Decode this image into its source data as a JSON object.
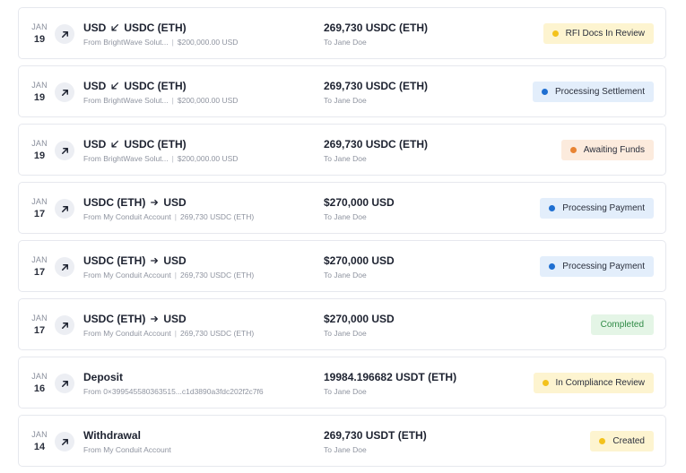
{
  "transactions": [
    {
      "month": "JAN",
      "day": "19",
      "kind": "conversion",
      "title_from": "USD",
      "title_to": "USDC (ETH)",
      "arrow": "arrow-down-left",
      "source": "From BrightWave Solut...",
      "source_amount": "$200,000.00 USD",
      "amount": "269,730 USDC (ETH)",
      "recipient": "To Jane Doe",
      "status": "RFI Docs In Review",
      "status_bg": "#fdf4d0",
      "status_dot": "#f3c21b",
      "status_text": "#2a2f3c"
    },
    {
      "month": "JAN",
      "day": "19",
      "kind": "conversion",
      "title_from": "USD",
      "title_to": "USDC (ETH)",
      "arrow": "arrow-down-left",
      "source": "From BrightWave Solut...",
      "source_amount": "$200,000.00 USD",
      "amount": "269,730 USDC (ETH)",
      "recipient": "To Jane Doe",
      "status": "Processing Settlement",
      "status_bg": "#e3eefb",
      "status_dot": "#1f6fd1",
      "status_text": "#2a2f3c"
    },
    {
      "month": "JAN",
      "day": "19",
      "kind": "conversion",
      "title_from": "USD",
      "title_to": "USDC (ETH)",
      "arrow": "arrow-down-left",
      "source": "From BrightWave Solut...",
      "source_amount": "$200,000.00 USD",
      "amount": "269,730 USDC (ETH)",
      "recipient": "To Jane Doe",
      "status": "Awaiting Funds",
      "status_bg": "#fcebdd",
      "status_dot": "#e88433",
      "status_text": "#2a2f3c"
    },
    {
      "month": "JAN",
      "day": "17",
      "kind": "conversion",
      "title_from": "USDC (ETH)",
      "title_to": "USD",
      "arrow": "arrow-right",
      "source": "From My Conduit Account",
      "source_amount": "269,730 USDC (ETH)",
      "amount": "$270,000 USD",
      "recipient": "To Jane Doe",
      "status": "Processing Payment",
      "status_bg": "#e3eefb",
      "status_dot": "#1f6fd1",
      "status_text": "#2a2f3c"
    },
    {
      "month": "JAN",
      "day": "17",
      "kind": "conversion",
      "title_from": "USDC (ETH)",
      "title_to": "USD",
      "arrow": "arrow-right",
      "source": "From My Conduit Account",
      "source_amount": "269,730 USDC (ETH)",
      "amount": "$270,000 USD",
      "recipient": "To Jane Doe",
      "status": "Processing Payment",
      "status_bg": "#e3eefb",
      "status_dot": "#1f6fd1",
      "status_text": "#2a2f3c"
    },
    {
      "month": "JAN",
      "day": "17",
      "kind": "conversion",
      "title_from": "USDC (ETH)",
      "title_to": "USD",
      "arrow": "arrow-right",
      "source": "From My Conduit Account",
      "source_amount": "269,730 USDC (ETH)",
      "amount": "$270,000 USD",
      "recipient": "To Jane Doe",
      "status": "Completed",
      "status_bg": "#e4f5e6",
      "status_dot": "",
      "status_text": "#2f8a45"
    },
    {
      "month": "JAN",
      "day": "16",
      "kind": "simple",
      "title": "Deposit",
      "source": "From 0×399545580363515...c1d3890a3fdc202f2c7f6",
      "source_amount": "",
      "amount": "19984.196682 USDT (ETH)",
      "recipient": "To Jane Doe",
      "status": "In Compliance Review",
      "status_bg": "#fdf4d0",
      "status_dot": "#f3c21b",
      "status_text": "#2a2f3c"
    },
    {
      "month": "JAN",
      "day": "14",
      "kind": "simple",
      "title": "Withdrawal",
      "source": "From My Conduit Account",
      "source_amount": "",
      "amount": "269,730 USDT (ETH)",
      "recipient": "To Jane Doe",
      "status": "Created",
      "status_bg": "#fdf4d0",
      "status_dot": "#f3c21b",
      "status_text": "#2a2f3c"
    }
  ]
}
